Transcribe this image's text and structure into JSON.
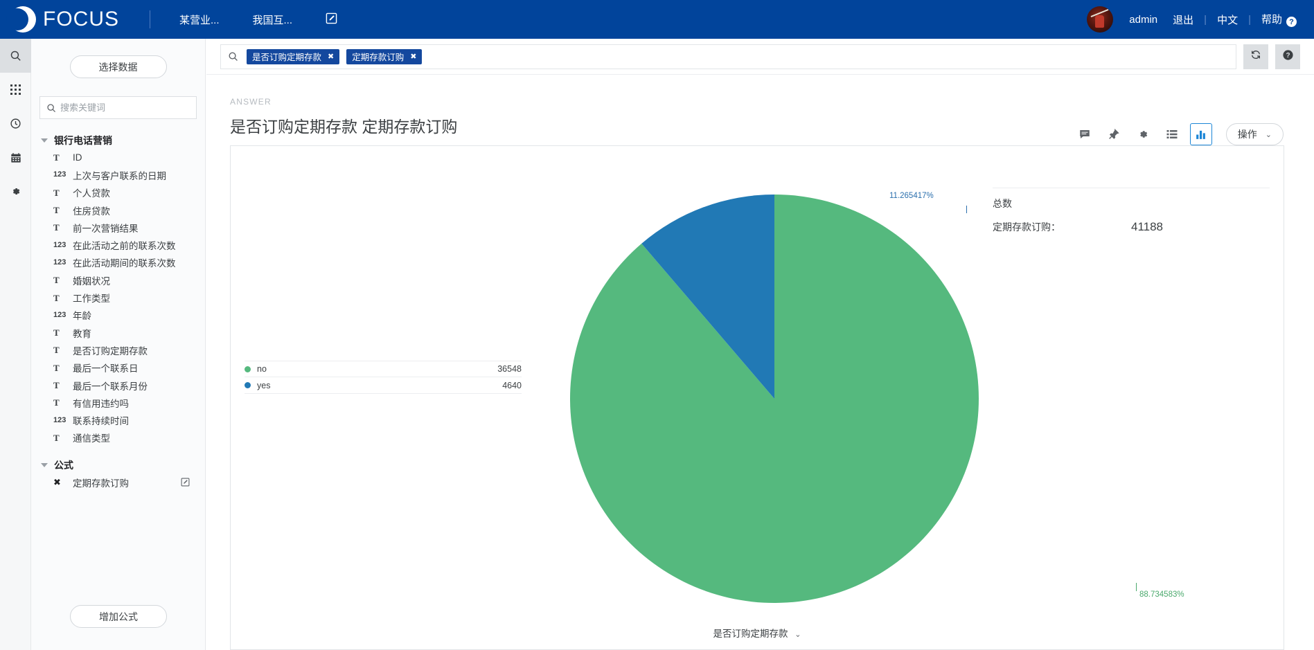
{
  "topbar": {
    "logo_text": "FOCUS",
    "nav": [
      {
        "label": "某营业...",
        "name": "nav-item-1"
      },
      {
        "label": "我国互...",
        "name": "nav-item-2"
      }
    ],
    "compose_icon": "compose-icon",
    "user": "admin",
    "logout": "退出",
    "language": "中文",
    "help": "帮助",
    "help_glyph": "?"
  },
  "rail": {
    "items": [
      {
        "name": "search-icon",
        "active": true
      },
      {
        "name": "grid-icon",
        "active": false
      },
      {
        "name": "clock-icon",
        "active": false
      },
      {
        "name": "calendar-icon",
        "active": false
      },
      {
        "name": "gear-icon",
        "active": false
      }
    ]
  },
  "sidebar": {
    "select_data_label": "选择数据",
    "search_placeholder": "搜索关键词",
    "add_formula_label": "增加公式",
    "groups": [
      {
        "label": "银行电话营销",
        "items": [
          {
            "type": "T",
            "label": "ID"
          },
          {
            "type": "123",
            "label": "上次与客户联系的日期"
          },
          {
            "type": "T",
            "label": "个人贷款"
          },
          {
            "type": "T",
            "label": "住房贷款"
          },
          {
            "type": "T",
            "label": "前一次营销结果"
          },
          {
            "type": "123",
            "label": "在此活动之前的联系次数"
          },
          {
            "type": "123",
            "label": "在此活动期间的联系次数"
          },
          {
            "type": "T",
            "label": "婚姻状况"
          },
          {
            "type": "T",
            "label": "工作类型"
          },
          {
            "type": "123",
            "label": "年龄"
          },
          {
            "type": "T",
            "label": "教育"
          },
          {
            "type": "T",
            "label": "是否订购定期存款"
          },
          {
            "type": "T",
            "label": "最后一个联系日"
          },
          {
            "type": "T",
            "label": "最后一个联系月份"
          },
          {
            "type": "T",
            "label": "有信用违约吗"
          },
          {
            "type": "123",
            "label": "联系持续时间"
          },
          {
            "type": "T",
            "label": "通信类型"
          }
        ]
      },
      {
        "label": "公式",
        "items": [
          {
            "type": "x",
            "label": "定期存款订购",
            "editable": true
          }
        ]
      }
    ]
  },
  "filterbar": {
    "search_icon": "search-icon",
    "chips": [
      {
        "label": "是否订购定期存款",
        "close": "✖"
      },
      {
        "label": "定期存款订购",
        "close": "✖"
      }
    ],
    "refresh_icon": "refresh-icon",
    "help_icon": "help-icon"
  },
  "answer": {
    "kicker": "ANSWER",
    "title": "是否订购定期存款 定期存款订购",
    "tools": [
      {
        "name": "comment-icon",
        "boxed": false
      },
      {
        "name": "pin-icon",
        "boxed": false
      },
      {
        "name": "gear-icon",
        "boxed": false
      },
      {
        "name": "list-icon",
        "boxed": false
      },
      {
        "name": "chart-icon",
        "boxed": true
      }
    ],
    "action_label": "操作",
    "action_chevron": "⌄"
  },
  "summary": {
    "title": "总数",
    "label": "定期存款订购：",
    "value": "41188"
  },
  "axis": {
    "label": "是否订购定期存款",
    "chevron": "⌄"
  },
  "colors": {
    "brand_blue": "#01449b",
    "chip_blue": "#14489e",
    "slice_green": "#55b97e",
    "slice_blue": "#2179b5",
    "accent_blue": "#1a85d6"
  },
  "chart_data": {
    "type": "pie",
    "title": "是否订购定期存款 定期存款订购",
    "xlabel": "是否订购定期存款",
    "ylabel": "定期存款订购",
    "legend_position": "left",
    "total": 41188,
    "total_label": "定期存款订购：",
    "categories": [
      "no",
      "yes"
    ],
    "values": [
      36548,
      4640
    ],
    "percent_labels": [
      "88.734583%",
      "11.265417%"
    ],
    "percents": [
      88.734583,
      11.265417
    ],
    "slice_colors": [
      "#55b97e",
      "#2179b5"
    ],
    "start_angle_deg": 0,
    "direction": "counterclockwise"
  }
}
